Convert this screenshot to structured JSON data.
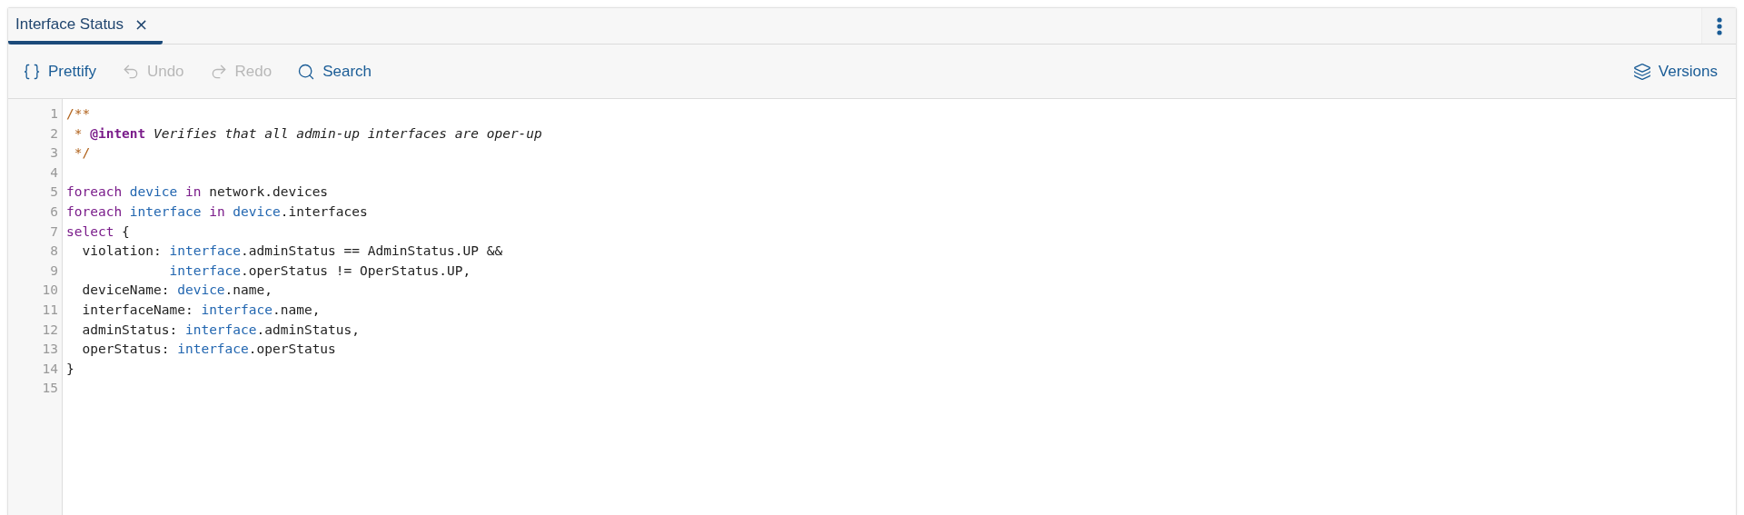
{
  "tabs": [
    {
      "label": "Interface Status",
      "selected": true,
      "closable": true,
      "close_glyph": "×"
    }
  ],
  "toolbar": {
    "left": [
      {
        "kind": "prettify",
        "label": "Prettify",
        "disabled": false
      },
      {
        "kind": "undo",
        "label": "Undo",
        "disabled": true
      },
      {
        "kind": "redo",
        "label": "Redo",
        "disabled": true
      },
      {
        "kind": "search",
        "label": "Search",
        "disabled": false
      }
    ],
    "right": [
      {
        "kind": "versions",
        "label": "Versions",
        "disabled": false
      }
    ]
  },
  "editor": {
    "lines": [
      {
        "number": "1",
        "tokens": [
          {
            "text": "/**",
            "kind": "comment"
          }
        ]
      },
      {
        "number": "2",
        "tokens": [
          {
            "text": " * ",
            "kind": "comment"
          },
          {
            "text": "@intent",
            "kind": "tag"
          },
          {
            "text": " Verifies that all admin-up interfaces are oper-up",
            "kind": "doc"
          }
        ]
      },
      {
        "number": "3",
        "tokens": [
          {
            "text": " */",
            "kind": "comment"
          }
        ]
      },
      {
        "number": "4"
      },
      {
        "number": "5",
        "tokens": [
          {
            "text": "foreach",
            "kind": "keyword"
          },
          {
            "text": " device",
            "kind": "variable"
          },
          {
            "text": " in",
            "kind": "keyword"
          },
          {
            "text": " network.devices",
            "kind": "plain"
          }
        ]
      },
      {
        "number": "6",
        "tokens": [
          {
            "text": "foreach",
            "kind": "keyword"
          },
          {
            "text": " interface",
            "kind": "variable"
          },
          {
            "text": " in",
            "kind": "keyword"
          },
          {
            "text": " device",
            "kind": "variable"
          },
          {
            "text": ".interfaces",
            "kind": "plain"
          }
        ]
      },
      {
        "number": "7",
        "tokens": [
          {
            "text": "select",
            "kind": "keyword"
          },
          {
            "text": " {",
            "kind": "plain"
          }
        ]
      },
      {
        "number": "8",
        "tokens": [
          {
            "text": "  violation: ",
            "kind": "plain"
          },
          {
            "text": "interface",
            "kind": "variable"
          },
          {
            "text": ".adminStatus == AdminStatus.UP &&",
            "kind": "plain"
          }
        ]
      },
      {
        "number": "9",
        "tokens": [
          {
            "text": "             interface",
            "kind": "variable"
          },
          {
            "text": ".operStatus != OperStatus.UP,",
            "kind": "plain"
          }
        ]
      },
      {
        "number": "10",
        "tokens": [
          {
            "text": "  deviceName: ",
            "kind": "plain"
          },
          {
            "text": "device",
            "kind": "variable"
          },
          {
            "text": ".name,",
            "kind": "plain"
          }
        ]
      },
      {
        "number": "11",
        "tokens": [
          {
            "text": "  interfaceName: ",
            "kind": "plain"
          },
          {
            "text": "interface",
            "kind": "variable"
          },
          {
            "text": ".name,",
            "kind": "plain"
          }
        ]
      },
      {
        "number": "12",
        "tokens": [
          {
            "text": "  adminStatus: ",
            "kind": "plain"
          },
          {
            "text": "interface",
            "kind": "variable"
          },
          {
            "text": ".adminStatus,",
            "kind": "plain"
          }
        ]
      },
      {
        "number": "13",
        "tokens": [
          {
            "text": "  operStatus: ",
            "kind": "plain"
          },
          {
            "text": "interface",
            "kind": "variable"
          },
          {
            "text": ".operStatus",
            "kind": "plain"
          }
        ]
      },
      {
        "number": "14",
        "tokens": [
          {
            "text": "}",
            "kind": "plain"
          }
        ]
      },
      {
        "number": "15"
      }
    ]
  }
}
